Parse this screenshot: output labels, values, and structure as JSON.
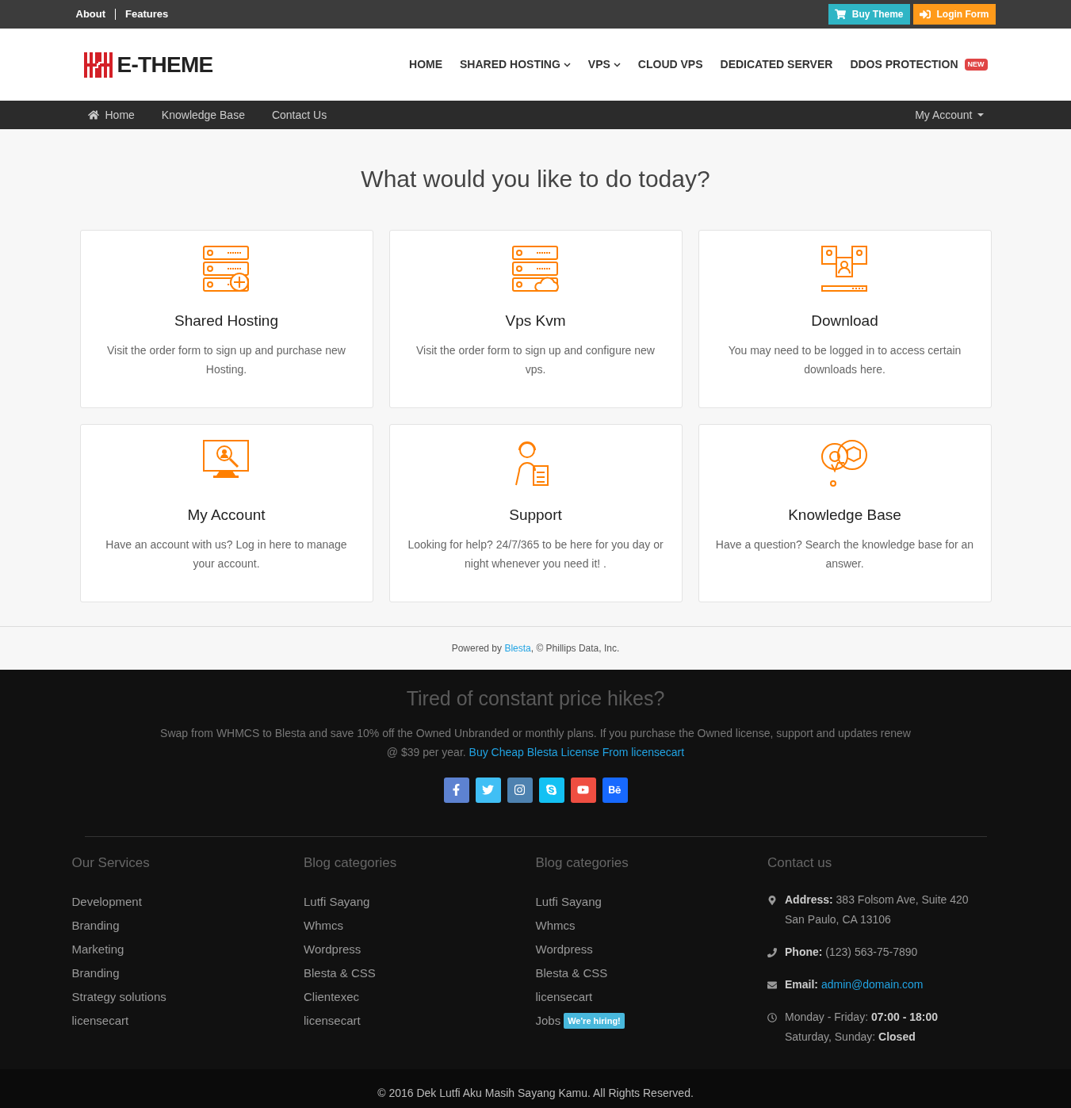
{
  "top_bar": {
    "links": [
      "About",
      "Features"
    ],
    "buttons": [
      {
        "label": "Buy Theme",
        "kind": "buy"
      },
      {
        "label": "Login Form",
        "kind": "login"
      }
    ]
  },
  "header": {
    "logo": "E-THEME",
    "nav": [
      {
        "label": "HOME",
        "dropdown": false
      },
      {
        "label": "SHARED HOSTING",
        "dropdown": true
      },
      {
        "label": "VPS",
        "dropdown": true
      },
      {
        "label": "CLOUD VPS",
        "dropdown": false
      },
      {
        "label": "DEDICATED SERVER",
        "dropdown": false
      },
      {
        "label": "DDOS PROTECTION",
        "dropdown": false,
        "badge": "NEW"
      }
    ]
  },
  "sub_nav": {
    "items": [
      {
        "label": "Home",
        "kind": "home"
      },
      {
        "label": "Knowledge Base",
        "kind": "link"
      },
      {
        "label": "Contact Us",
        "kind": "link"
      }
    ],
    "account": "My Account"
  },
  "heading": "What would you like to do today?",
  "cards": [
    {
      "kind": "hosting",
      "title": "Shared Hosting",
      "text": "Visit the order form to sign up and purchase new Hosting."
    },
    {
      "kind": "vps",
      "title": "Vps Kvm",
      "text": "Visit the order form to sign up and configure new vps."
    },
    {
      "kind": "download",
      "title": "Download",
      "text": "You may need to be logged in to access certain downloads here."
    },
    {
      "kind": "account",
      "title": "My Account",
      "text": "Have an account with us? Log in here to manage your account."
    },
    {
      "kind": "support",
      "title": "Support",
      "text": "Looking for help? 24/7/365 to be here for you day or night whenever you need it! ."
    },
    {
      "kind": "knowledge",
      "title": "Knowledge Base",
      "text": "Have a question? Search the knowledge base for an answer."
    }
  ],
  "powered": {
    "prefix": "Powered by",
    "link": "Blesta",
    "suffix": ", © Phillips Data, Inc."
  },
  "promo": {
    "title": "Tired of constant price hikes?",
    "text": "Swap from WHMCS to Blesta and save 10% off the Owned Unbranded or monthly plans. If you purchase the Owned license, support and updates renew @ $39 per year.",
    "link": "Buy Cheap Blesta License From licensecart"
  },
  "social": [
    {
      "kind": "facebook",
      "color": "#5d82d1"
    },
    {
      "kind": "twitter",
      "color": "#40bff5"
    },
    {
      "kind": "instagram",
      "color": "#4e82b0"
    },
    {
      "kind": "skype",
      "color": "#13c1f3"
    },
    {
      "kind": "youtube",
      "color": "#ef4e41"
    },
    {
      "kind": "behance",
      "color": "#1769ff"
    }
  ],
  "footer_columns": [
    {
      "title": "Our Services",
      "items": [
        {
          "label": "Development"
        },
        {
          "label": "Branding"
        },
        {
          "label": "Marketing"
        },
        {
          "label": "Branding"
        },
        {
          "label": "Strategy solutions"
        },
        {
          "label": "licensecart"
        }
      ]
    },
    {
      "title": "Blog categories",
      "items": [
        {
          "label": "Lutfi Sayang"
        },
        {
          "label": "Whmcs"
        },
        {
          "label": "Wordpress"
        },
        {
          "label": "Blesta & CSS"
        },
        {
          "label": "Clientexec"
        },
        {
          "label": "licensecart"
        }
      ]
    },
    {
      "title": "Blog categories",
      "items": [
        {
          "label": "Lutfi Sayang"
        },
        {
          "label": "Whmcs"
        },
        {
          "label": "Wordpress"
        },
        {
          "label": "Blesta & CSS"
        },
        {
          "label": "licensecart"
        },
        {
          "label": "Jobs",
          "badge": "We're hiring!"
        }
      ]
    }
  ],
  "contact": {
    "title": "Contact us",
    "entries": [
      {
        "kind": "address",
        "lines": [
          "**Address:** 383 Folsom Ave, Suite 420",
          "San Paulo, CA 13106"
        ]
      },
      {
        "kind": "phone",
        "lines": [
          "**Phone:** (123) 563-75-7890"
        ]
      },
      {
        "kind": "email",
        "label": "Email:",
        "link": "admin@domain.com"
      },
      {
        "kind": "hours",
        "lines": [
          "Monday - Friday: **07:00 - 18:00**",
          "Saturday, Sunday: **Closed**"
        ]
      }
    ]
  },
  "copyright": "© 2016 Dek Lutfi Aku Masih Sayang Kamu. All Rights Reserved."
}
